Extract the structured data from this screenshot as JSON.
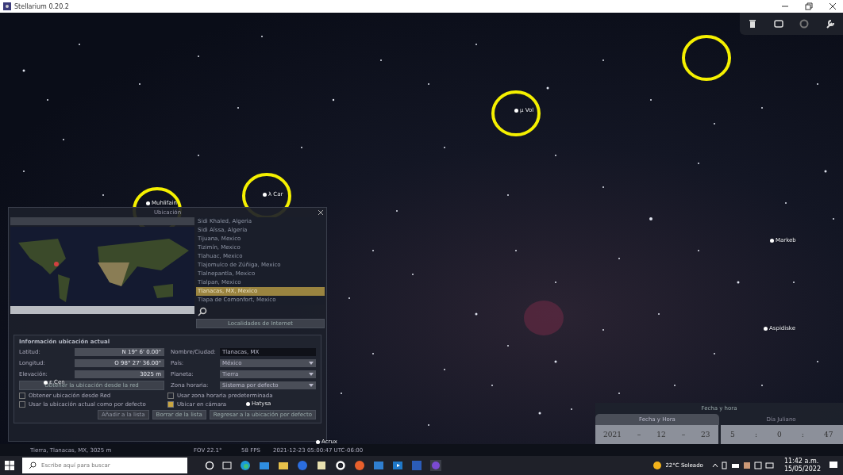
{
  "window": {
    "title": "Stellarium 0.20.2"
  },
  "sky_labels": [
    "μ Vol",
    "λ Car",
    "Muhlifain",
    "Markeb",
    "Aspidiske",
    "Hatysa",
    "ε Cen",
    "Acrux"
  ],
  "location_dialog": {
    "title": "Ubicación",
    "cities": [
      {
        "name": "Sidi Khaled, Algeria",
        "selected": false
      },
      {
        "name": "Sidi Aïssa, Algeria",
        "selected": false
      },
      {
        "name": "Tijuana, Mexico",
        "selected": false
      },
      {
        "name": "Tizimín, Mexico",
        "selected": false
      },
      {
        "name": "Tlahuac, Mexico",
        "selected": false
      },
      {
        "name": "Tlajomulco de Zúñiga, Mexico",
        "selected": false
      },
      {
        "name": "Tlalnepantla, Mexico",
        "selected": false
      },
      {
        "name": "Tlalpan, Mexico",
        "selected": false
      },
      {
        "name": "Tlanacas, MX, Mexico",
        "selected": true
      },
      {
        "name": "Tlapa de Comonfort, Mexico",
        "selected": false
      }
    ],
    "list_button": "Localidades de Internet",
    "section_title": "Información ubicación actual",
    "fields_left": [
      {
        "label": "Latitud:",
        "value": "N 19° 6' 0.00\""
      },
      {
        "label": "Longitud:",
        "value": "O 98° 27' 36.00\""
      },
      {
        "label": "Elevación:",
        "value": "3025 m"
      }
    ],
    "network_button": "Obtener la ubicación desde la red",
    "fields_right": [
      {
        "label": "Nombre/Ciudad:",
        "value": "Tlanacas, MX",
        "kind": "text"
      },
      {
        "label": "País:",
        "value": "México",
        "kind": "select"
      },
      {
        "label": "Planeta:",
        "value": "Tierra",
        "kind": "select"
      },
      {
        "label": "Zona horaria:",
        "value": "Sistema por defecto",
        "kind": "select"
      }
    ],
    "checks": [
      {
        "label": "Obtener ubicación desde Red",
        "checked": false
      },
      {
        "label": "Usar zona horaria predeterminada",
        "checked": false
      },
      {
        "label": "Usar la ubicación actual como por defecto",
        "checked": false
      },
      {
        "label": "Ubicar en cámara",
        "checked": true
      }
    ],
    "buttons": [
      {
        "label": "Añadir a la lista",
        "disabled": true
      },
      {
        "label": "Borrar de la lista",
        "disabled": false
      },
      {
        "label": "Regresar a la ubicación por defecto",
        "disabled": false
      }
    ]
  },
  "datetime_panel": {
    "title": "Fecha y hora",
    "tabs": [
      {
        "label": "Fecha y Hora",
        "selected": true
      },
      {
        "label": "Día Juliano",
        "selected": false
      }
    ],
    "date": [
      "2021",
      "12",
      "23"
    ],
    "date_sep": "–",
    "time": [
      "5",
      "0",
      "47"
    ],
    "time_sep": ":"
  },
  "status_bar": {
    "location": "Tierra, Tlanacas, MX, 3025 m",
    "fov": "FOV 22.1°",
    "fps": "58 FPS",
    "datetime": "2021-12-23 05:00:47 UTC-06:00"
  },
  "taskbar": {
    "search": {
      "placeholder": "Escribe aquí para buscar"
    },
    "weather": "22°C  Soleado",
    "time": "11:42 a.m.",
    "date": "15/05/2022"
  }
}
